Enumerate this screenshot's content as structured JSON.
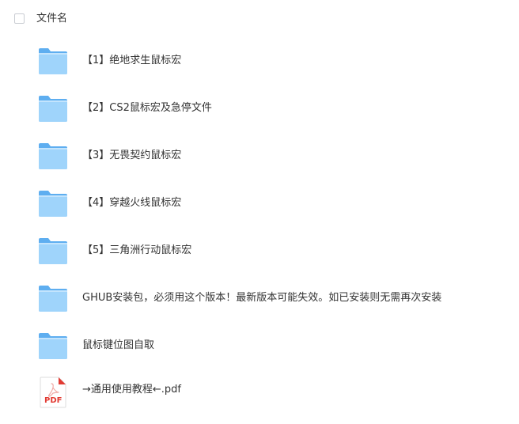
{
  "header": {
    "column_label": "文件名"
  },
  "files": [
    {
      "name": "【1】绝地求生鼠标宏",
      "type": "folder"
    },
    {
      "name": "【2】CS2鼠标宏及急停文件",
      "type": "folder"
    },
    {
      "name": "【3】无畏契约鼠标宏",
      "type": "folder"
    },
    {
      "name": "【4】穿越火线鼠标宏",
      "type": "folder"
    },
    {
      "name": "【5】三角洲行动鼠标宏",
      "type": "folder"
    },
    {
      "name": "GHUB安装包，必须用这个版本！最新版本可能失效。如已安装则无需再次安装",
      "type": "folder"
    },
    {
      "name": "鼠标键位图自取",
      "type": "folder"
    },
    {
      "name": "→通用使用教程←.pdf",
      "type": "pdf",
      "badge": "PDF"
    }
  ],
  "colors": {
    "folder_light": "#9fd4fb",
    "folder_dark": "#5eaef0",
    "pdf_red": "#e23b33",
    "text": "#333333"
  }
}
